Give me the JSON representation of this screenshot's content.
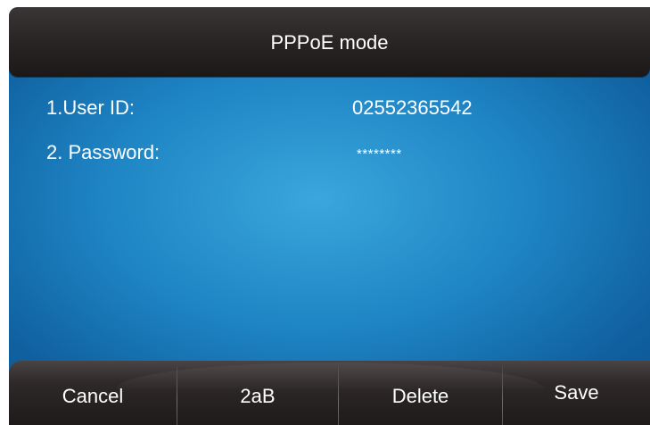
{
  "header": {
    "title": "PPPoE mode"
  },
  "fields": [
    {
      "label": "1.User ID:",
      "value": "02552365542"
    },
    {
      "label": "2. Password:",
      "value": "********"
    }
  ],
  "softkeys": {
    "cancel": "Cancel",
    "input_mode": "2aB",
    "delete": "Delete",
    "save": "Save"
  },
  "colors": {
    "screen_background": "#1e84c4",
    "bar_background": "#2b2626",
    "text": "#ffffff",
    "cursor": "#e8503a"
  }
}
